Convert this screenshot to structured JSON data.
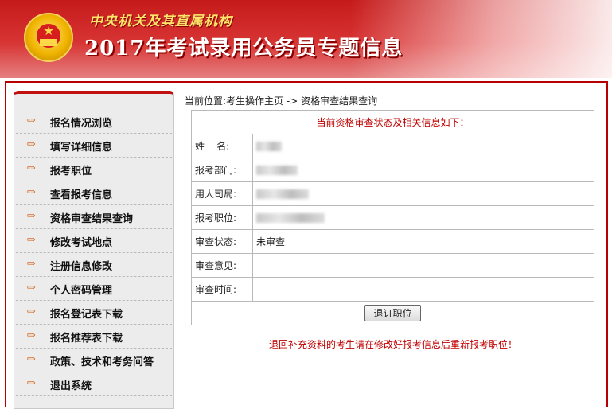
{
  "banner": {
    "subtitle": "中央机关及其直属机构",
    "title": "2017年考试录用公务员专题信息",
    "emblem_icon": "national-emblem"
  },
  "colors": {
    "brand_red": "#c51a1a",
    "notice_red": "#c00000"
  },
  "sidebar": {
    "items": [
      {
        "label": "报名情况浏览",
        "icon": "arrow-right-icon"
      },
      {
        "label": "填写详细信息",
        "icon": "arrow-right-icon"
      },
      {
        "label": "报考职位",
        "icon": "arrow-right-icon"
      },
      {
        "label": "查看报考信息",
        "icon": "arrow-right-icon"
      },
      {
        "label": "资格审查结果查询",
        "icon": "arrow-right-icon"
      },
      {
        "label": "修改考试地点",
        "icon": "arrow-right-icon"
      },
      {
        "label": "注册信息修改",
        "icon": "arrow-right-icon"
      },
      {
        "label": "个人密码管理",
        "icon": "arrow-right-icon"
      },
      {
        "label": "报名登记表下载",
        "icon": "arrow-right-icon"
      },
      {
        "label": "报名推荐表下载",
        "icon": "arrow-right-icon"
      },
      {
        "label": "政策、技术和考务问答",
        "icon": "arrow-right-icon"
      },
      {
        "label": "退出系统",
        "icon": "arrow-right-icon"
      }
    ]
  },
  "breadcrumb": {
    "prefix": "当前位置:",
    "home": "考生操作主页",
    "sep": "->",
    "current": "资格审查结果查询"
  },
  "info": {
    "header": "当前资格审查状态及相关信息如下：",
    "rows": [
      {
        "label": "姓    名:",
        "value": ""
      },
      {
        "label": "报考部门:",
        "value": ""
      },
      {
        "label": "用人司局:",
        "value": ""
      },
      {
        "label": "报考职位:",
        "value": ""
      },
      {
        "label": "审查状态:",
        "value": "未审查"
      },
      {
        "label": "审查意见:",
        "value": ""
      },
      {
        "label": "审查时间:",
        "value": ""
      }
    ],
    "button": "退订职位"
  },
  "notice": "退回补充资料的考生请在修改好报考信息后重新报考职位！"
}
